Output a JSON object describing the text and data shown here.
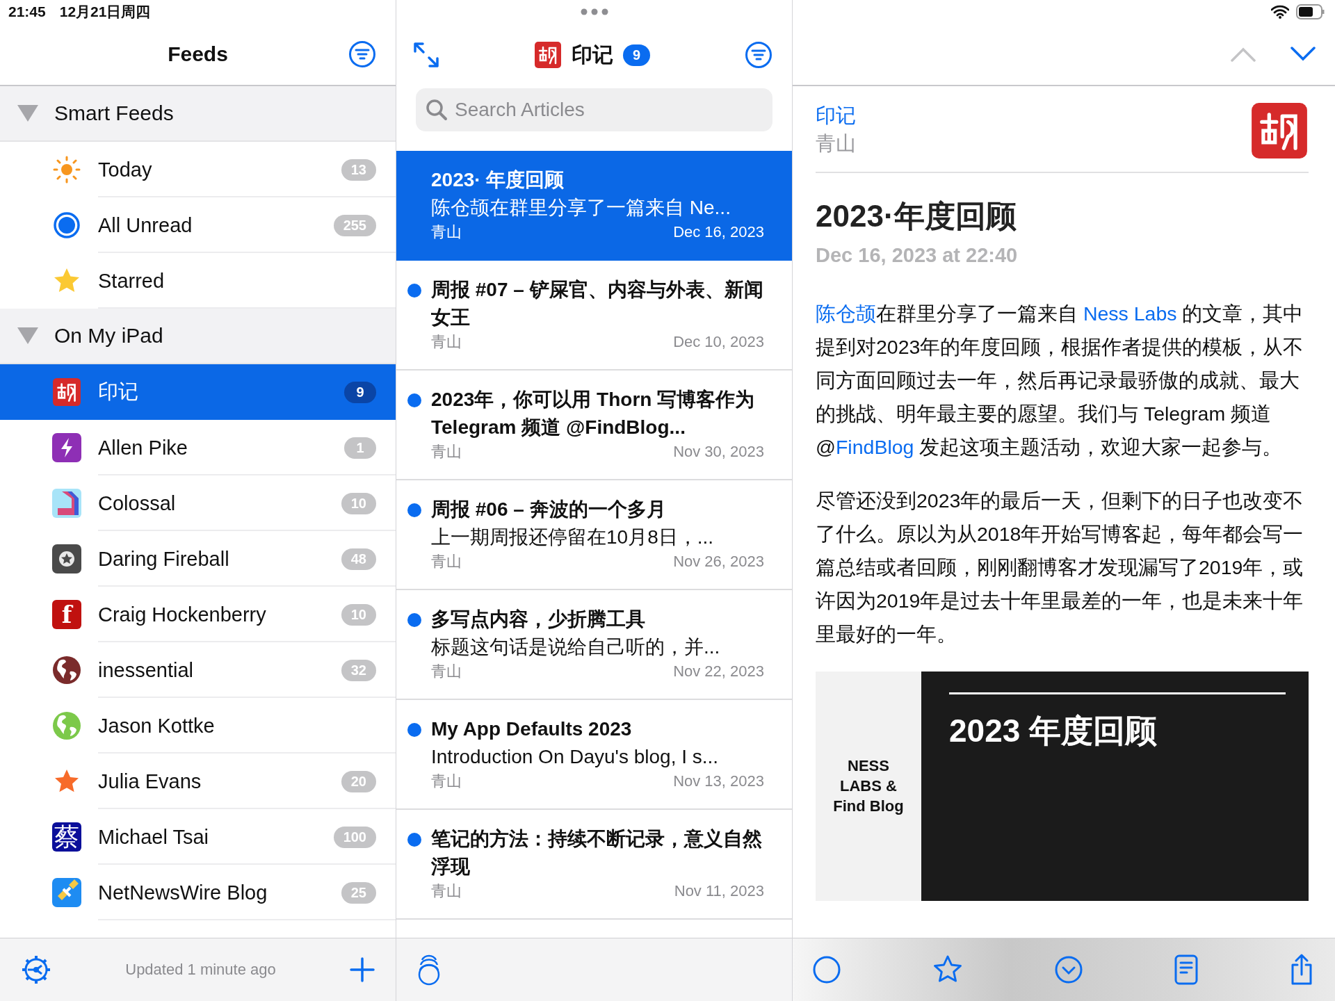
{
  "status_bar": {
    "time": "21:45",
    "date": "12月21日周四"
  },
  "sidebar": {
    "title": "Feeds",
    "sections": [
      {
        "name": "Smart Feeds",
        "expanded": true,
        "items": [
          {
            "name": "Today",
            "count": "13",
            "selected": false
          },
          {
            "name": "All Unread",
            "count": "255",
            "selected": false
          },
          {
            "name": "Starred",
            "selected": false
          }
        ]
      },
      {
        "name": "On My iPad",
        "expanded": true,
        "items": [
          {
            "name": "印记",
            "count": "9",
            "selected": true
          },
          {
            "name": "Allen Pike",
            "count": "1",
            "selected": false
          },
          {
            "name": "Colossal",
            "count": "10",
            "selected": false
          },
          {
            "name": "Daring Fireball",
            "count": "48",
            "selected": false
          },
          {
            "name": "Craig Hockenberry",
            "count": "10",
            "selected": false,
            "logo_text": "f"
          },
          {
            "name": "inessential",
            "count": "32",
            "selected": false
          },
          {
            "name": "Jason Kottke",
            "selected": false
          },
          {
            "name": "Julia Evans",
            "count": "20",
            "selected": false
          },
          {
            "name": "Michael Tsai",
            "count": "100",
            "selected": false,
            "logo_text": "蔡"
          },
          {
            "name": "NetNewsWire Blog",
            "count": "25",
            "selected": false
          }
        ]
      }
    ],
    "status": "Updated 1 minute ago"
  },
  "timeline": {
    "feed_name": "印记",
    "unread_count": "9",
    "search": {
      "placeholder": "Search Articles"
    },
    "articles": [
      {
        "title": "2023· 年度回顾",
        "summary": "陈仓颉在群里分享了一篇来自 Ne...",
        "author": "青山",
        "date": "Dec 16, 2023",
        "unread": false,
        "selected": true
      },
      {
        "title": "周报 #07 – 铲屎官、内容与外表、新闻女王",
        "author": "青山",
        "date": "Dec 10, 2023",
        "unread": true,
        "selected": false
      },
      {
        "title": "2023年，你可以用 Thorn 写博客作为 Telegram 频道 @FindBlog...",
        "author": "青山",
        "date": "Nov 30, 2023",
        "unread": true,
        "selected": false
      },
      {
        "title": "周报 #06 – 奔波的一个多月",
        "summary": "上一期周报还停留在10月8日，...",
        "author": "青山",
        "date": "Nov 26, 2023",
        "unread": true,
        "selected": false
      },
      {
        "title": "多写点内容，少折腾工具",
        "summary": "标题这句话是说给自己听的，并...",
        "author": "青山",
        "date": "Nov 22, 2023",
        "unread": true,
        "selected": false
      },
      {
        "title": "My App Defaults 2023",
        "summary": "Introduction On Dayu's blog, I s...",
        "author": "青山",
        "date": "Nov 13, 2023",
        "unread": true,
        "selected": false
      },
      {
        "title": "笔记的方法：持续不断记录，意义自然浮现",
        "author": "青山",
        "date": "Nov 11, 2023",
        "unread": true,
        "selected": false
      }
    ]
  },
  "article": {
    "feed_name": "印记",
    "author": "青山",
    "title": "2023·年度回顾",
    "datetime": "Dec 16, 2023 at 22:40",
    "previous": {
      "disabled": true
    },
    "next": {
      "disabled": false
    },
    "paragraphs": [
      [
        {
          "text": "陈仓颉",
          "link": true
        },
        {
          "text": "在群里分享了一篇来自 ",
          "link": false
        },
        {
          "text": "Ness Labs",
          "link": true
        },
        {
          "text": " 的文章，其中提到对2023年的年度回顾，根据作者提供的模板，从不同方面回顾过去一年，然后再记录最骄傲的成就、最大的挑战、明年最主要的愿望。我们与 Telegram 频道 @",
          "link": false
        },
        {
          "text": "FindBlog",
          "link": true
        },
        {
          "text": " 发起这项主题活动，欢迎大家一起参与。",
          "link": false
        }
      ],
      [
        {
          "text": "尽管还没到2023年的最后一天，但剩下的日子也改变不了什么。原以为从2018年开始写博客起，每年都会写一篇总结或者回顾，刚刚翻博客才发现漏写了2019年，或许因为2019年是过去十年里最差的一年，也是未来十年里最好的一年。",
          "link": false
        }
      ]
    ],
    "image": {
      "side_text": "NESS LABS & Find Blog",
      "title": "2023 年度回顾"
    }
  }
}
